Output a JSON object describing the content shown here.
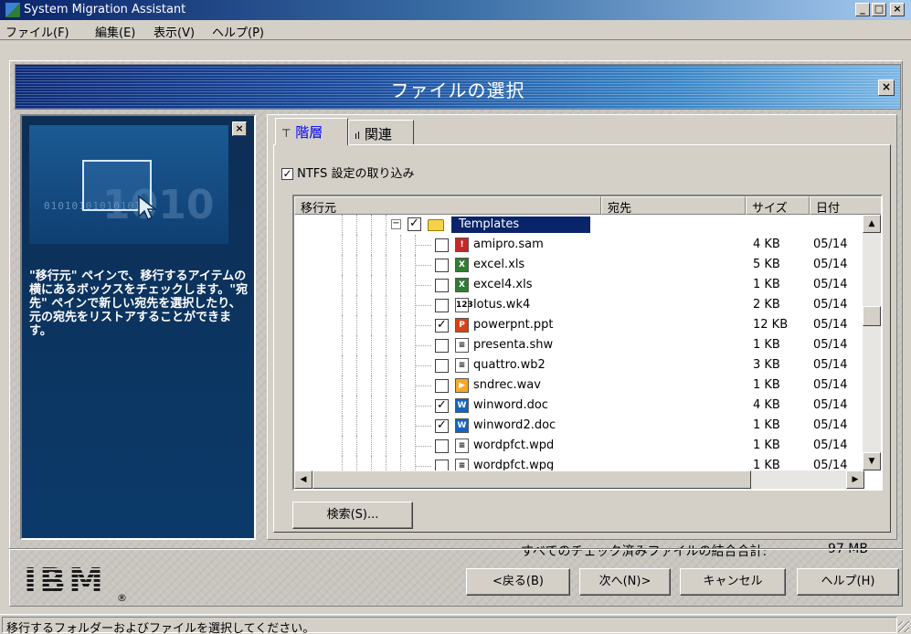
{
  "window": {
    "title": "System Migration Assistant",
    "min": "_",
    "max": "□",
    "close": "×"
  },
  "menu": [
    "ファイル(F)",
    "編集(E)",
    "表示(V)",
    "ヘルプ(P)"
  ],
  "header": {
    "title": "ファイルの選択",
    "close": "×"
  },
  "left_panel": {
    "close": "×",
    "binary_text": "0101010101010101",
    "big_text": "1010",
    "help_text": "\"移行元\" ペインで、移行するアイテムの横にあるボックスをチェックします。\"宛先\" ペインで新しい宛先を選択したり、元の宛先をリストアすることができます。"
  },
  "tabs": [
    {
      "icon": "tree-icon",
      "glyph": "⊤",
      "label": "階層",
      "active": true
    },
    {
      "icon": "signal-icon",
      "glyph": "ıl",
      "label": "関連",
      "active": false
    }
  ],
  "ntfs_checkbox": {
    "label": "NTFS 設定の取り込み",
    "checked": true,
    "mark": "✓"
  },
  "columns": [
    "移行元",
    "宛先",
    "サイズ",
    "日付"
  ],
  "folder": {
    "name": "Templates",
    "expander": "−",
    "checked": true
  },
  "files": [
    {
      "name": "amipro.sam",
      "size": "4 KB",
      "date": "05/14",
      "checked": false,
      "icon": "amipro-icon",
      "icon_color": "#c62828",
      "glyph": "!"
    },
    {
      "name": "excel.xls",
      "size": "5 KB",
      "date": "05/14",
      "checked": false,
      "icon": "excel-icon",
      "icon_color": "#2e7d32",
      "glyph": "X"
    },
    {
      "name": "excel4.xls",
      "size": "1 KB",
      "date": "05/14",
      "checked": false,
      "icon": "excel-icon",
      "icon_color": "#2e7d32",
      "glyph": "X"
    },
    {
      "name": "lotus.wk4",
      "size": "2 KB",
      "date": "05/14",
      "checked": false,
      "icon": "lotus-icon",
      "icon_color": "#ffffff",
      "glyph": "123"
    },
    {
      "name": "powerpnt.ppt",
      "size": "12 KB",
      "date": "05/14",
      "checked": true,
      "icon": "powerpoint-icon",
      "icon_color": "#d84315",
      "glyph": "P"
    },
    {
      "name": "presenta.shw",
      "size": "1 KB",
      "date": "05/14",
      "checked": false,
      "icon": "document-icon",
      "icon_color": "#ffffff",
      "glyph": "≡"
    },
    {
      "name": "quattro.wb2",
      "size": "3 KB",
      "date": "05/14",
      "checked": false,
      "icon": "document-icon",
      "icon_color": "#ffffff",
      "glyph": "≡"
    },
    {
      "name": "sndrec.wav",
      "size": "1 KB",
      "date": "05/14",
      "checked": false,
      "icon": "sound-icon",
      "icon_color": "#f9a825",
      "glyph": "▶"
    },
    {
      "name": "winword.doc",
      "size": "4 KB",
      "date": "05/14",
      "checked": true,
      "icon": "word-icon",
      "icon_color": "#1565c0",
      "glyph": "W"
    },
    {
      "name": "winword2.doc",
      "size": "1 KB",
      "date": "05/14",
      "checked": true,
      "icon": "word-icon",
      "icon_color": "#1565c0",
      "glyph": "W"
    },
    {
      "name": "wordpfct.wpd",
      "size": "1 KB",
      "date": "05/14",
      "checked": false,
      "icon": "document-icon",
      "icon_color": "#ffffff",
      "glyph": "≡"
    },
    {
      "name": "wordpfct.wpg",
      "size": "1 KB",
      "date": "05/14",
      "checked": false,
      "icon": "document-icon",
      "icon_color": "#ffffff",
      "glyph": "≡"
    }
  ],
  "scroll": {
    "up": "▲",
    "down": "▼",
    "left": "◀",
    "right": "▶"
  },
  "search_button": "検索(S)...",
  "summary": {
    "label": "すべてのチェック済みファイルの結合合計:",
    "value": "97 MB"
  },
  "buttons": {
    "back": "<戻る(B)",
    "next": "次へ(N)>",
    "cancel": "キャンセル",
    "help": "ヘルプ(H)"
  },
  "logo": {
    "text": "IBM",
    "reg": "®"
  },
  "status": "移行するフォルダーおよびファイルを選択してください。"
}
